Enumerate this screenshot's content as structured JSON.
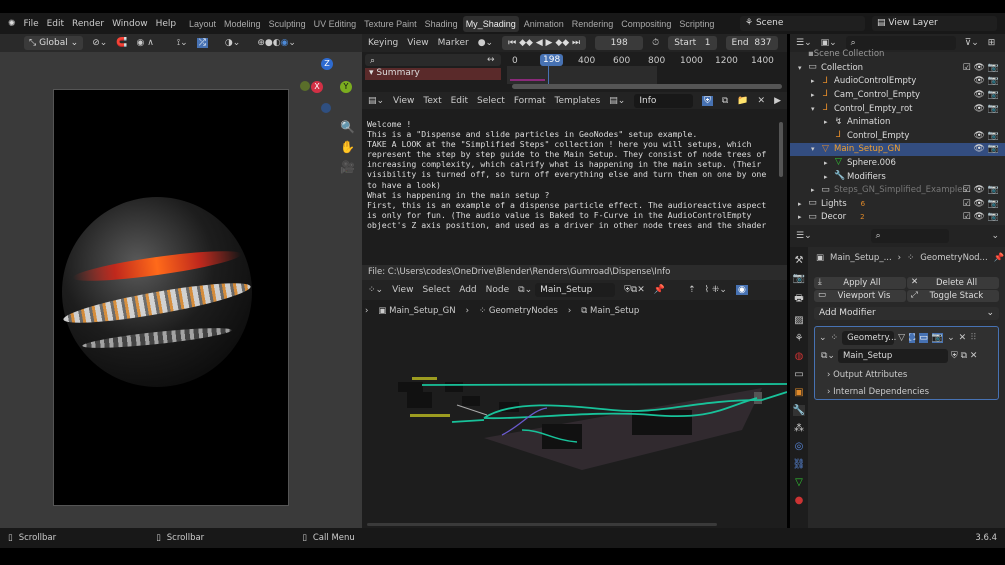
{
  "menu": {
    "items": [
      "File",
      "Edit",
      "Render",
      "Window",
      "Help"
    ]
  },
  "workspaces": [
    "Layout",
    "Modeling",
    "Sculpting",
    "UV Editing",
    "Texture Paint",
    "Shading",
    "My_Shading",
    "Animation",
    "Rendering",
    "Compositing",
    "Scripting"
  ],
  "active_workspace": "My_Shading",
  "scene": "Scene",
  "view_layer": "View Layer",
  "viewport": {
    "orientation": "Global",
    "gizmo_axes": [
      "X",
      "Y",
      "Z"
    ]
  },
  "timeline": {
    "menus": [
      "Keying",
      "View",
      "Marker"
    ],
    "current_frame": "198",
    "start_label": "Start",
    "start": "1",
    "end_label": "End",
    "end": "837",
    "ruler": [
      "0",
      "198",
      "400",
      "600",
      "800",
      "1000",
      "1200",
      "1400"
    ],
    "summary": "Summary"
  },
  "text_editor": {
    "menus": [
      "View",
      "Text",
      "Edit",
      "Select",
      "Format",
      "Templates"
    ],
    "text_name": "Info",
    "lines": [
      "Welcome !",
      "",
      "This is a \"Dispense and slide particles in GeoNodes\" setup example.",
      "",
      "TAKE A LOOK at the \"Simplified Steps\" collection ! here you will setups, which",
      "represent the step by step guide to the Main Setup. They consist of node trees of",
      "increasing complexity, which calrify what is happening in the main setup. (Their",
      "visibility is turned off, so turn off everything else and turn them on one by one",
      "to have a look)",
      "",
      "What is happening in the main setup ?",
      "",
      "First, this is an example of a dispense particle effect. The audioreactive aspect",
      "is only for fun. (The audio value is Baked to F-Curve in the AudioControlEmpty",
      "object's Z axis position, and used as a driver in other node trees and the shader"
    ],
    "file_path": "File: C:\\Users\\codes\\OneDrive\\Blender\\Renders\\Gumroad\\Dispense\\Info"
  },
  "node_editor": {
    "menus": [
      "View",
      "Select",
      "Add",
      "Node"
    ],
    "node_tree": "Main_Setup",
    "breadcrumb": [
      "Main_Setup_GN",
      "GeometryNodes",
      "Main_Setup"
    ]
  },
  "outliner": {
    "root": "Scene Collection",
    "items": [
      {
        "label": "Collection",
        "depth": 0,
        "icon": "collection-icon"
      },
      {
        "label": "AudioControlEmpty",
        "depth": 1,
        "icon": "empty-icon"
      },
      {
        "label": "Cam_Control_Empty",
        "depth": 1,
        "icon": "empty-icon"
      },
      {
        "label": "Control_Empty_rot",
        "depth": 1,
        "icon": "empty-icon"
      },
      {
        "label": "Animation",
        "depth": 2,
        "icon": "animation-icon"
      },
      {
        "label": "Control_Empty",
        "depth": 2,
        "icon": "empty-icon"
      },
      {
        "label": "Main_Setup_GN",
        "depth": 1,
        "icon": "mesh-object-icon",
        "selected": true
      },
      {
        "label": "Sphere.006",
        "depth": 2,
        "icon": "mesh-data-icon"
      },
      {
        "label": "Modifiers",
        "depth": 2,
        "icon": "wrench-icon"
      },
      {
        "label": "Steps_GN_Simplified_Examples",
        "depth": 1,
        "icon": "collection-icon",
        "disabled": true
      },
      {
        "label": "Lights",
        "depth": 0,
        "icon": "collection-icon",
        "badge": "6"
      },
      {
        "label": "Decor",
        "depth": 0,
        "icon": "collection-icon",
        "badge": "2"
      }
    ]
  },
  "properties": {
    "object": "Main_Setup_...",
    "modifier_path": "GeometryNod...",
    "apply_all": "Apply All",
    "delete_all": "Delete All",
    "viewport_vis": "Viewport Vis",
    "toggle_stack": "Toggle Stack",
    "add_modifier": "Add Modifier",
    "modifier_name": "Geometry...",
    "node_group": "Main_Setup",
    "output_attributes": "Output Attributes",
    "internal_dependencies": "Internal Dependencies"
  },
  "status": {
    "items": [
      "Scrollbar",
      "Scrollbar",
      "Call Menu"
    ],
    "version": "3.6.4"
  },
  "colors": {
    "accent": "#4772b3",
    "selected_row": "#334d80",
    "wire": "#18c29a",
    "summary": "#5a2a2a"
  }
}
